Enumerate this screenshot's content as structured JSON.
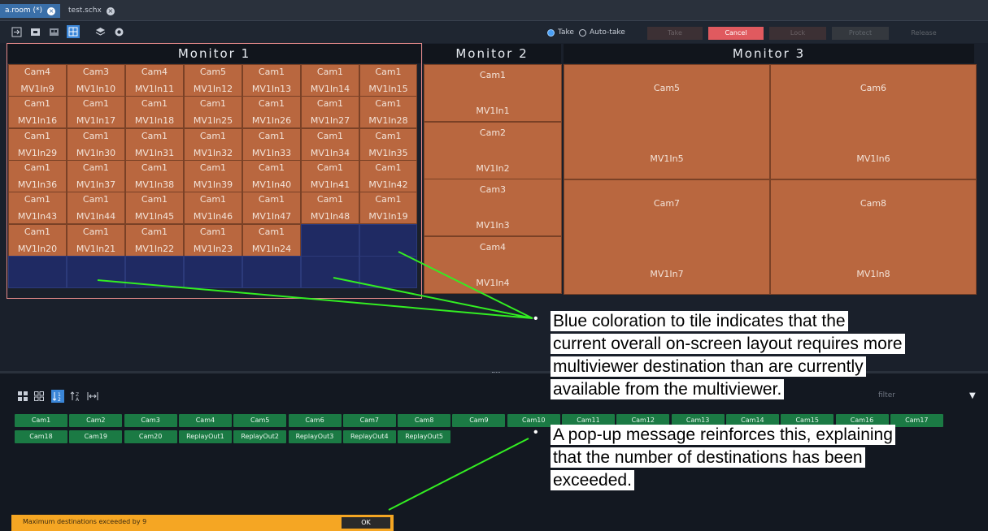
{
  "tabs": [
    {
      "label": "a.room (*)",
      "active": true
    },
    {
      "label": "test.schx",
      "active": false
    }
  ],
  "toolbar": {
    "icons": [
      "export-icon",
      "screen-icon",
      "layout-icon",
      "grid-icon",
      "layers-icon",
      "camera-icon"
    ],
    "take_mode_label": "Take",
    "auto_take_label": "Auto-take",
    "buttons": {
      "take": "Take",
      "cancel": "Cancel",
      "lock": "Lock",
      "protect": "Protect",
      "release": "Release"
    }
  },
  "monitors": [
    {
      "title": "Monitor 1"
    },
    {
      "title": "Monitor 2"
    },
    {
      "title": "Monitor 3"
    }
  ],
  "monitor1": {
    "rows": [
      [
        [
          "Cam4",
          "MV1In9"
        ],
        [
          "Cam3",
          "MV1In10"
        ],
        [
          "Cam4",
          "MV1In11"
        ],
        [
          "Cam5",
          "MV1In12"
        ],
        [
          "Cam1",
          "MV1In13"
        ],
        [
          "Cam1",
          "MV1In14"
        ],
        [
          "Cam1",
          "MV1In15"
        ]
      ],
      [
        [
          "Cam1",
          "MV1In16"
        ],
        [
          "Cam1",
          "MV1In17"
        ],
        [
          "Cam1",
          "MV1In18"
        ],
        [
          "Cam1",
          "MV1In25"
        ],
        [
          "Cam1",
          "MV1In26"
        ],
        [
          "Cam1",
          "MV1In27"
        ],
        [
          "Cam1",
          "MV1In28"
        ]
      ],
      [
        [
          "Cam1",
          "MV1In29"
        ],
        [
          "Cam1",
          "MV1In30"
        ],
        [
          "Cam1",
          "MV1In31"
        ],
        [
          "Cam1",
          "MV1In32"
        ],
        [
          "Cam1",
          "MV1In33"
        ],
        [
          "Cam1",
          "MV1In34"
        ],
        [
          "Cam1",
          "MV1In35"
        ]
      ],
      [
        [
          "Cam1",
          "MV1In36"
        ],
        [
          "Cam1",
          "MV1In37"
        ],
        [
          "Cam1",
          "MV1In38"
        ],
        [
          "Cam1",
          "MV1In39"
        ],
        [
          "Cam1",
          "MV1In40"
        ],
        [
          "Cam1",
          "MV1In41"
        ],
        [
          "Cam1",
          "MV1In42"
        ]
      ],
      [
        [
          "Cam1",
          "MV1In43"
        ],
        [
          "Cam1",
          "MV1In44"
        ],
        [
          "Cam1",
          "MV1In45"
        ],
        [
          "Cam1",
          "MV1In46"
        ],
        [
          "Cam1",
          "MV1In47"
        ],
        [
          "Cam1",
          "MV1In48"
        ],
        [
          "Cam1",
          "MV1In19"
        ]
      ],
      [
        [
          "Cam1",
          "MV1In20"
        ],
        [
          "Cam1",
          "MV1In21"
        ],
        [
          "Cam1",
          "MV1In22"
        ],
        [
          "Cam1",
          "MV1In23"
        ],
        [
          "Cam1",
          "MV1In24"
        ],
        [
          "",
          ""
        ],
        [
          "",
          ""
        ]
      ],
      [
        [
          "",
          ""
        ],
        [
          "",
          ""
        ],
        [
          "",
          ""
        ],
        [
          "",
          ""
        ],
        [
          "",
          ""
        ],
        [
          "",
          ""
        ],
        [
          "",
          ""
        ]
      ]
    ]
  },
  "monitor2": [
    [
      "Cam1",
      "MV1In1"
    ],
    [
      "Cam2",
      "MV1In2"
    ],
    [
      "Cam3",
      "MV1In3"
    ],
    [
      "Cam4",
      "MV1In4"
    ]
  ],
  "monitor3": [
    [
      "Cam5",
      "MV1In5"
    ],
    [
      "Cam6",
      "MV1In6"
    ],
    [
      "Cam7",
      "MV1In7"
    ],
    [
      "Cam8",
      "MV1In8"
    ]
  ],
  "lower": {
    "view_icons": [
      "grid-large-icon",
      "grid-small-icon",
      "sort-asc-icon",
      "sort-desc-icon",
      "fit-icon"
    ],
    "filter_placeholder": "filter",
    "sources_row1": [
      "Cam1",
      "Cam2",
      "Cam3",
      "Cam4",
      "Cam5",
      "Cam6",
      "Cam7",
      "Cam8",
      "Cam9",
      "Cam10",
      "Cam11",
      "Cam12",
      "Cam13",
      "Cam14",
      "Cam15",
      "Cam16",
      "Cam17"
    ],
    "sources_row2": [
      "Cam18",
      "Cam19",
      "Cam20",
      "ReplayOut1",
      "ReplayOut2",
      "ReplayOut3",
      "ReplayOut4",
      "ReplayOut5"
    ],
    "message": "Maximum destinations exceeded by 9",
    "ok_label": "OK"
  },
  "annotations": {
    "note1": [
      "Blue coloration to tile indicates that the",
      "current overall on-screen layout requires more",
      "multiviewer destination than are currently",
      "available from the multiviewer."
    ],
    "note2": [
      "A pop-up message reinforces this, explaining",
      "that the number of destinations has been",
      "exceeded."
    ]
  },
  "colors": {
    "tile": "#b9673f",
    "tile_blue": "#1f2a63",
    "source_button": "#1b7a44",
    "popup": "#f5a623",
    "cancel": "#e05a5f",
    "annotation_line": "#33ee22"
  }
}
